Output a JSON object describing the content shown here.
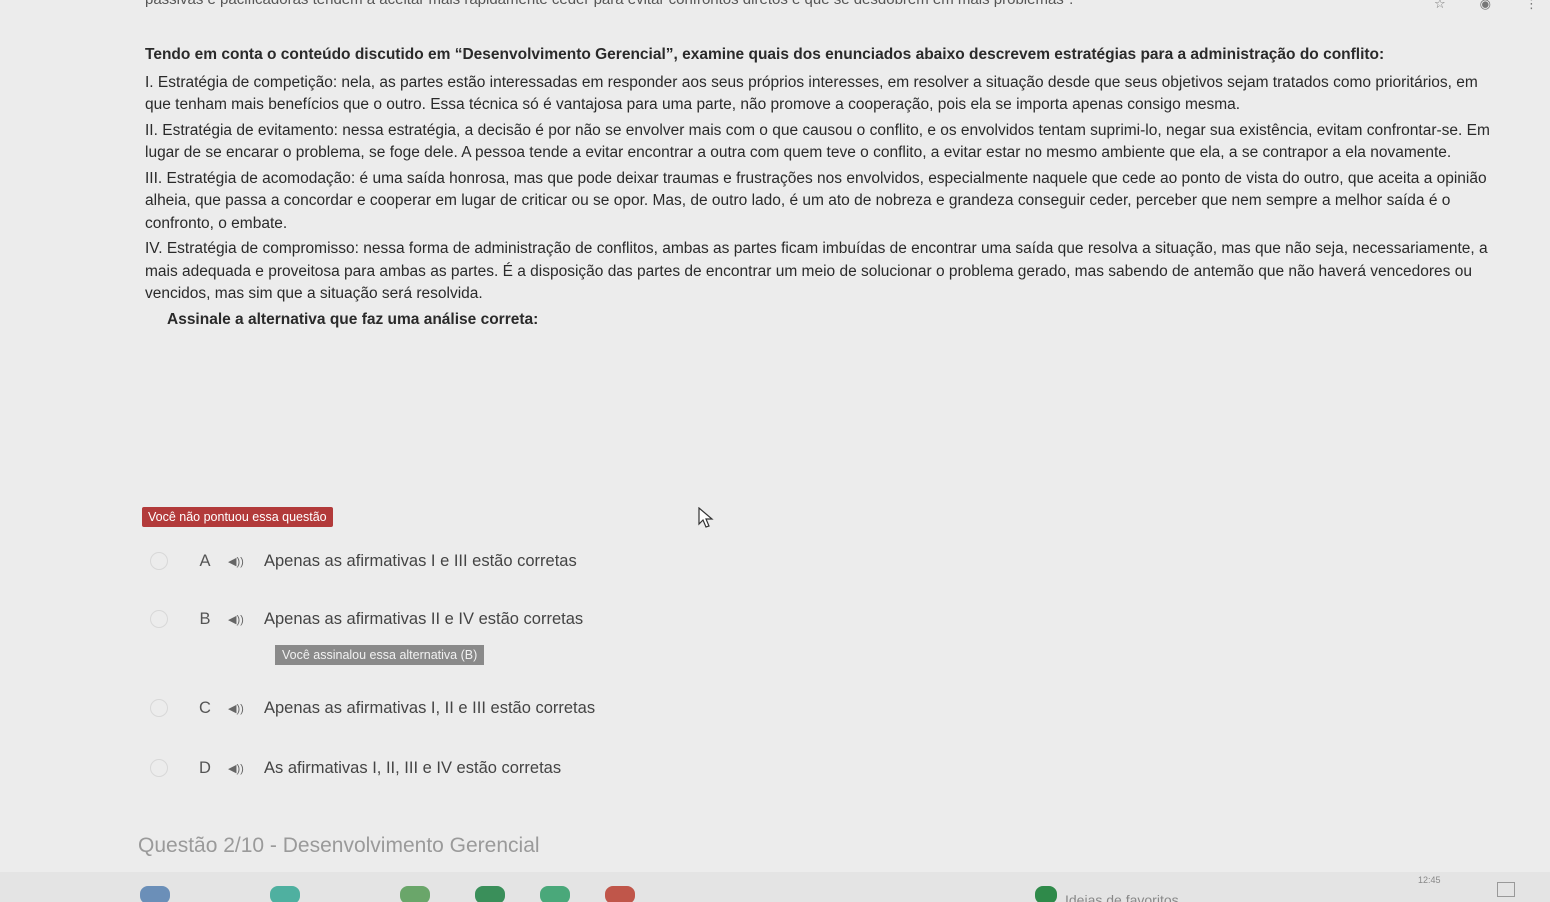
{
  "top": {
    "cut_text": "passivas e pacificadoras tendem a aceitar mais rapidamente ceder para evitar confrontos diretos e que se desdobrem em mais problemas\"."
  },
  "question": {
    "prompt": "Tendo em conta o conteúdo discutido em “Desenvolvimento Gerencial”, examine quais dos enunciados abaixo descrevem estratégias para a administração do conflito:",
    "statements": [
      "I. Estratégia de competição: nela, as partes estão interessadas em responder aos seus próprios interesses, em resolver a situação desde que seus objetivos sejam tratados como prioritários, em que tenham mais benefícios que o outro. Essa técnica só é vantajosa para uma parte, não promove a cooperação, pois ela se importa apenas consigo mesma.",
      "II. Estratégia de evitamento: nessa estratégia, a decisão é por não se envolver mais com o que causou o conflito, e os envolvidos tentam suprimi-lo, negar sua existência, evitam confrontar-se. Em lugar de se encarar o problema, se foge dele. A pessoa tende a evitar encontrar a outra com quem teve o conflito, a evitar estar no mesmo ambiente que ela, a se contrapor a ela novamente.",
      "III. Estratégia de acomodação: é uma saída honrosa, mas que pode deixar traumas e frustrações nos envolvidos, especialmente naquele que cede ao ponto de vista do outro, que aceita a opinião alheia, que passa a concordar e cooperar em lugar de criticar ou se opor. Mas, de outro lado, é um ato de nobreza e grandeza conseguir ceder, perceber que nem sempre a melhor saída é o confronto, o embate.",
      "IV. Estratégia de compromisso: nessa forma de administração de conflitos, ambas as partes ficam imbuídas de encontrar uma saída que resolva a situação, mas que não seja, necessariamente, a mais adequada e proveitosa para ambas as partes. É a disposição das partes de encontrar um meio de solucionar o problema gerado, mas sabendo de antemão que não haverá vencedores ou vencidos, mas sim que a situação será resolvida."
    ],
    "instruction": "Assinale a alternativa que faz uma análise correta:"
  },
  "result_badge": "Você não pontuou essa questão",
  "options": [
    {
      "letter": "A",
      "text": "Apenas as afirmativas I e III estão corretas"
    },
    {
      "letter": "B",
      "text": "Apenas as afirmativas II e IV estão corretas"
    },
    {
      "letter": "C",
      "text": "Apenas as afirmativas I, II e III estão corretas"
    },
    {
      "letter": "D",
      "text": "As afirmativas I, II, III e IV estão corretas"
    }
  ],
  "selected_note": "Você assinalou essa alternativa (B)",
  "next_question_title": "Questão 2/10 - Desenvolvimento Gerencial",
  "taskbar": {
    "favorites_label": "Ideias de favoritos",
    "clock": "12:45"
  },
  "colors": {
    "badge_red": "#b23a3a",
    "note_gray": "#8a8a8a",
    "background": "#ececec"
  }
}
